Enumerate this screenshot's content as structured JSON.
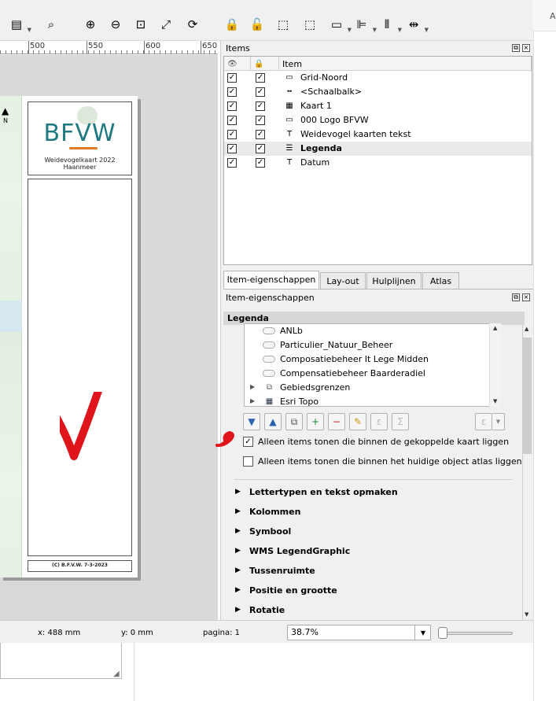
{
  "toolbar": {
    "buttons": [
      {
        "name": "add-items-from-template-icon"
      },
      {
        "name": "zoom-to-selected-icon"
      },
      {
        "name": "zoom-in-icon"
      },
      {
        "name": "zoom-out-icon"
      },
      {
        "name": "zoom-100-icon"
      },
      {
        "name": "zoom-full-icon"
      },
      {
        "name": "refresh-icon"
      },
      {
        "name": "lock-items-icon"
      },
      {
        "name": "unlock-items-icon"
      },
      {
        "name": "select-items-icon"
      },
      {
        "name": "deselect-items-icon"
      },
      {
        "name": "raise-items-icon"
      },
      {
        "name": "align-items-icon"
      },
      {
        "name": "distribute-items-icon"
      },
      {
        "name": "resize-items-icon"
      }
    ]
  },
  "edge": {
    "letter": "A"
  },
  "ruler": {
    "labels": [
      "500",
      "550",
      "600",
      "650"
    ]
  },
  "page": {
    "north_label": "N",
    "logo_text": "BFVW",
    "title_line1": "Weidevogelkaart 2022",
    "title_line2": "Haanmeer",
    "date_text": "(C) B.F.V.W.  7-3-2023"
  },
  "status": {
    "x": "x: 488 mm",
    "y": "y: 0 mm",
    "page": "pagina: 1",
    "zoom": "38.7%"
  },
  "items_panel": {
    "title": "Items",
    "columns": [
      "",
      "",
      "Item"
    ],
    "rows": [
      {
        "label": "Grid-Noord",
        "icon": "picture-icon",
        "visible": true,
        "locked": true,
        "selected": false
      },
      {
        "label": "<Schaalbalk>",
        "icon": "scalebar-icon",
        "visible": true,
        "locked": true,
        "selected": false
      },
      {
        "label": "Kaart 1",
        "icon": "map-icon",
        "visible": true,
        "locked": true,
        "selected": false
      },
      {
        "label": "000 Logo BFVW",
        "icon": "picture-icon",
        "visible": true,
        "locked": true,
        "selected": false
      },
      {
        "label": "Weidevogel kaarten tekst",
        "icon": "text-icon",
        "visible": true,
        "locked": true,
        "selected": false
      },
      {
        "label": "Legenda",
        "icon": "legend-icon",
        "visible": true,
        "locked": true,
        "selected": true
      },
      {
        "label": "Datum",
        "icon": "text-icon",
        "visible": true,
        "locked": true,
        "selected": false
      }
    ]
  },
  "tabs": [
    "Item-eigenschappen",
    "Lay-out",
    "Hulplijnen",
    "Atlas"
  ],
  "props_panel": {
    "title": "Item-eigenschappen",
    "section": "Legenda",
    "tree": [
      {
        "label": "ANLb",
        "kind": "cloud",
        "caret": false
      },
      {
        "label": "Particulier_Natuur_Beheer",
        "kind": "cloud",
        "caret": false
      },
      {
        "label": "Composatiebeheer It Lege Midden",
        "kind": "cloud",
        "caret": false
      },
      {
        "label": "Compensatiebeheer Baarderadiel",
        "kind": "cloud",
        "caret": false
      },
      {
        "label": "Gebiedsgrenzen",
        "kind": "group",
        "caret": true
      },
      {
        "label": "Esri Topo",
        "kind": "raster",
        "caret": true
      }
    ],
    "buttons": [
      {
        "name": "move-down-icon",
        "glyph": "▼"
      },
      {
        "name": "move-up-icon",
        "glyph": "▲"
      },
      {
        "name": "add-group-icon",
        "glyph": "⧉"
      },
      {
        "name": "add-item-icon",
        "glyph": "+"
      },
      {
        "name": "remove-item-icon",
        "glyph": "−"
      },
      {
        "name": "edit-icon",
        "glyph": "✎"
      },
      {
        "name": "expression-icon",
        "glyph": "ε"
      },
      {
        "name": "sum-icon",
        "glyph": "Σ"
      },
      {
        "name": "expression-dropdown-icon",
        "glyph": "ε"
      }
    ],
    "checkboxes": [
      {
        "label": "Alleen items tonen die binnen de gekoppelde kaart liggen",
        "checked": true
      },
      {
        "label": "Alleen items tonen die binnen het huidige object atlas liggen",
        "checked": false
      }
    ],
    "sections": [
      "Lettertypen en tekst opmaken",
      "Kolommen",
      "Symbool",
      "WMS LegendGraphic",
      "Tussenruimte",
      "Positie en grootte",
      "Rotatie"
    ]
  },
  "colors": {
    "logo": "#1e7a7f",
    "logo_accent": "#e07a28",
    "annotation": "#e0151b"
  }
}
